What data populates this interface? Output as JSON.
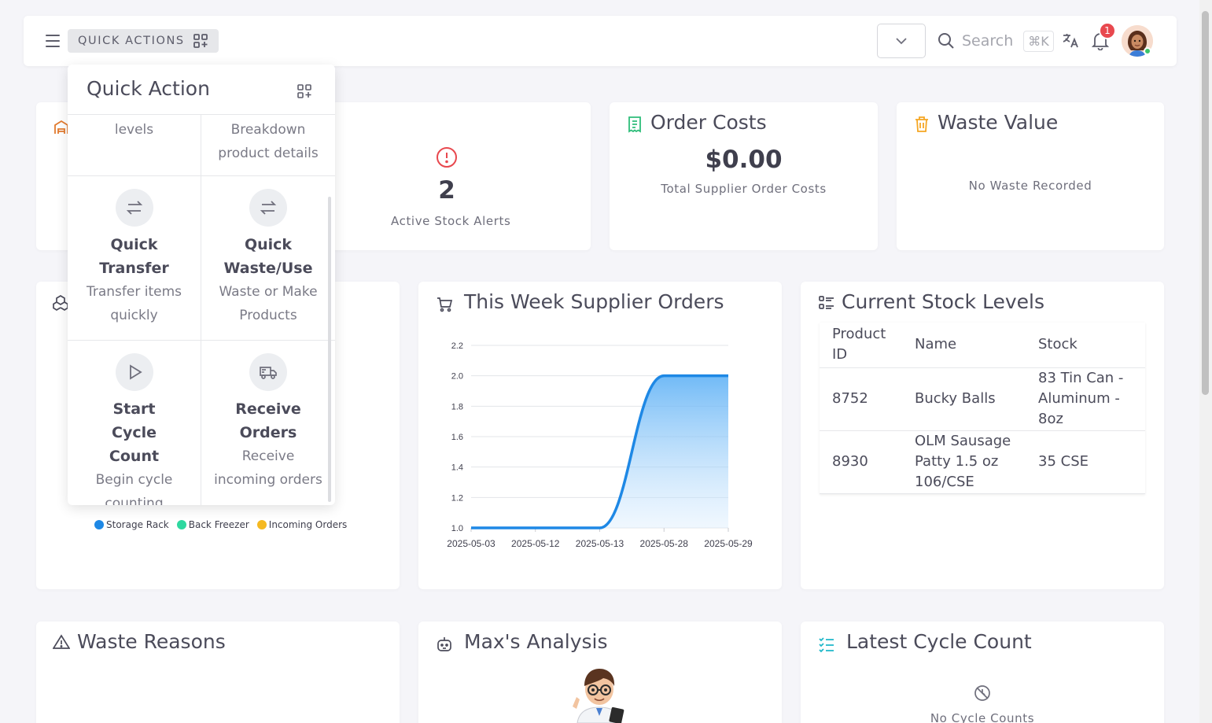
{
  "navbar": {
    "quick_actions_label": "QUICK ACTIONS",
    "search_placeholder": "Search",
    "search_shortcut": "⌘K",
    "notification_count": "1"
  },
  "quick_action_panel": {
    "title": "Quick Action",
    "items": [
      {
        "name": "",
        "desc": "levels",
        "icon": "partial"
      },
      {
        "name": "",
        "desc": "Breakdown product details",
        "icon": "partial"
      },
      {
        "name": "Quick Transfer",
        "desc": "Transfer items quickly",
        "icon": "transfer-icon"
      },
      {
        "name": "Quick Waste/Use",
        "desc": "Waste or Make Products",
        "icon": "transfer-icon"
      },
      {
        "name": "Start Cycle Count",
        "desc": "Begin cycle counting",
        "icon": "play-icon"
      },
      {
        "name": "Receive Orders",
        "desc": "Receive incoming orders",
        "icon": "truck-icon"
      }
    ]
  },
  "cards": {
    "stock_alerts": {
      "value": "2",
      "label": "Active Stock Alerts"
    },
    "order_costs": {
      "title": "Order Costs",
      "value": "$0.00",
      "label": "Total Supplier Order Costs"
    },
    "waste_value": {
      "title": "Waste Value",
      "label": "No Waste Recorded"
    },
    "supplier_orders": {
      "title": "This Week Supplier Orders"
    },
    "stock_levels": {
      "title": "Current Stock Levels",
      "columns": [
        "Product ID",
        "Name",
        "Stock"
      ],
      "rows": [
        [
          "8752",
          "Bucky Balls",
          "83 Tin Can - Aluminum - 8oz"
        ],
        [
          "8930",
          "OLM Sausage Patty 1.5 oz 106/CSE",
          "35 CSE"
        ]
      ]
    },
    "locations_legend": [
      "Storage Rack",
      "Back Freezer",
      "Incoming Orders"
    ],
    "waste_reasons": {
      "title": "Waste Reasons"
    },
    "max_analysis": {
      "title": "Max's Analysis"
    },
    "cycle_count": {
      "title": "Latest Cycle Count",
      "label": "No Cycle Counts"
    }
  },
  "colors": {
    "accent": "#1e88e5",
    "legend": [
      "#1e88e5",
      "#2ed8a0",
      "#f5b921"
    ],
    "alert": "#e8484e"
  },
  "chart_data": {
    "type": "area",
    "x": [
      "2025-05-03",
      "2025-05-12",
      "2025-05-13",
      "2025-05-28",
      "2025-05-29"
    ],
    "series": [
      {
        "values": [
          1.0,
          1.0,
          1.0,
          2.0,
          2.0
        ]
      }
    ],
    "yticks": [
      "1.0",
      "1.2",
      "1.4",
      "1.6",
      "1.8",
      "2.0",
      "2.2"
    ],
    "ylim": [
      1.0,
      2.2
    ],
    "grid": true
  }
}
